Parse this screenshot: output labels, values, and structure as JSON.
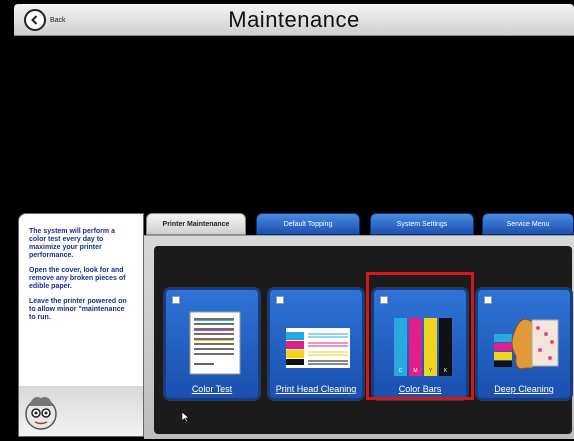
{
  "header": {
    "back_label": "Back",
    "title": "Maintenance"
  },
  "info": {
    "paragraphs": [
      "The system will perform a color test every day to maximize your printer performance.",
      "Open the cover, look for and remove any broken pieces of edible paper.",
      "Leave the printer powered on to allow minor \"maintenance to run."
    ]
  },
  "tabs": [
    {
      "label": "Printer Maintenance",
      "active": true
    },
    {
      "label": "Default Topping",
      "active": false
    },
    {
      "label": "System Settings",
      "active": false
    },
    {
      "label": "Service Menu",
      "active": false
    }
  ],
  "tiles": [
    {
      "label": "Color Test",
      "icon": "color-test-sheet-icon",
      "selected": false
    },
    {
      "label": "Print Head Cleaning",
      "icon": "print-head-cleaning-icon",
      "selected": false
    },
    {
      "label": "Color Bars",
      "icon": "color-bars-icon",
      "selected": true
    },
    {
      "label": "Deep Cleaning",
      "icon": "deep-cleaning-icon",
      "selected": false
    }
  ],
  "color_bar_letters": [
    "C",
    "M",
    "Y",
    "K"
  ],
  "colors": {
    "tab_blue": "#1b4fb0",
    "tile_blue": "#2f74d6",
    "highlight_red": "#d4171c",
    "info_text": "#1a2f8a"
  }
}
